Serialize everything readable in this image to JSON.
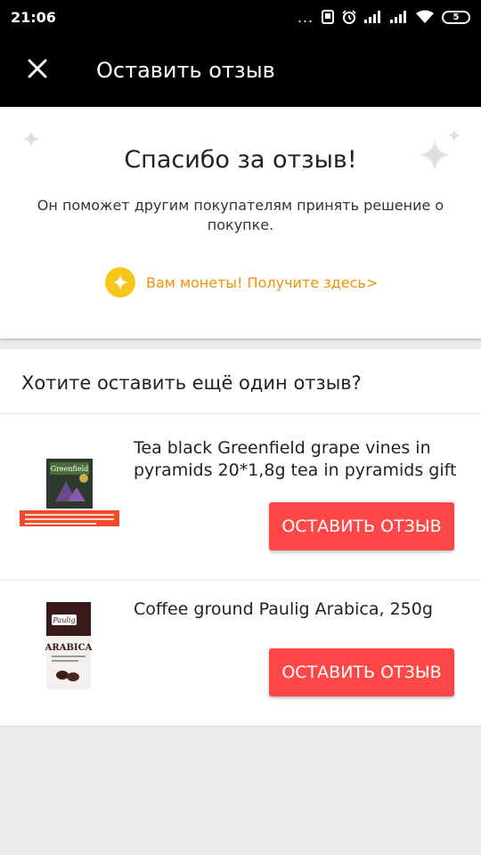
{
  "status_bar": {
    "time": "21:06",
    "dots": "...",
    "battery": "5"
  },
  "app_bar": {
    "close_icon": "close-icon",
    "title": "Оставить отзыв"
  },
  "thanks": {
    "title": "Спасибо за отзыв!",
    "subtitle": "Он поможет другим покупателям принять решение о покупке.",
    "coins_link": "Вам монеты! Получите здесь>",
    "coin_color": "#f7c61a",
    "link_color": "#f29100"
  },
  "more_reviews": {
    "title": "Хотите оставить ещё один отзыв?",
    "products": [
      {
        "name": "Tea black Greenfield grape vines in pyramids 20*1,8g tea in pyramids gift",
        "button": "ОСТАВИТЬ ОТЗЫВ",
        "image_brand": "Greenfield"
      },
      {
        "name": "Coffee ground Paulig Arabica, 250g",
        "button": "ОСТАВИТЬ ОТЗЫВ",
        "image_brand": "Paulig",
        "image_label": "ARABICA"
      }
    ],
    "button_color": "#ff4747"
  }
}
